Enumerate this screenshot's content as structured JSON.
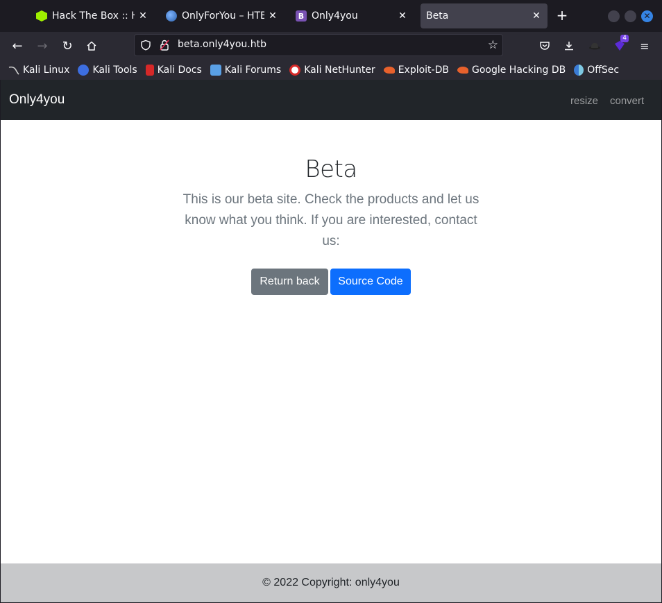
{
  "browser": {
    "tabs": [
      {
        "title": "Hack The Box :: Hack",
        "favicon": "htb-cube-icon",
        "active": false
      },
      {
        "title": "OnlyForYou – HTB -",
        "favicon": "globe-icon",
        "active": false
      },
      {
        "title": "Only4you",
        "favicon": "bootstrap-icon",
        "active": false
      },
      {
        "title": "Beta",
        "favicon": "",
        "active": true
      }
    ],
    "url": "beta.only4you.htb",
    "extension_badge": "4",
    "bookmarks": [
      {
        "label": "Kali Linux",
        "icon": "kali-dragon-icon",
        "color": "#d0d0d0"
      },
      {
        "label": "Kali Tools",
        "icon": "kali-tools-icon",
        "color": "#3d6ee0"
      },
      {
        "label": "Kali Docs",
        "icon": "kali-docs-icon",
        "color": "#d62828"
      },
      {
        "label": "Kali Forums",
        "icon": "kali-forums-icon",
        "color": "#5aa0e6"
      },
      {
        "label": "Kali NetHunter",
        "icon": "nethunter-icon",
        "color": "#d62828"
      },
      {
        "label": "Exploit-DB",
        "icon": "exploit-db-icon",
        "color": "#e8612c"
      },
      {
        "label": "Google Hacking DB",
        "icon": "ghdb-icon",
        "color": "#e8612c"
      },
      {
        "label": "OffSec",
        "icon": "offsec-icon",
        "color": "#3a7bd5"
      }
    ]
  },
  "site": {
    "brand": "Only4you",
    "nav_links": [
      "resize",
      "convert"
    ],
    "hero": {
      "title": "Beta",
      "lead": "This is our beta site. Check the products and let us know what you think. If you are interested, contact us:"
    },
    "buttons": {
      "return_back": "Return back",
      "source_code": "Source Code"
    },
    "footer": "© 2022 Copyright: only4you"
  }
}
